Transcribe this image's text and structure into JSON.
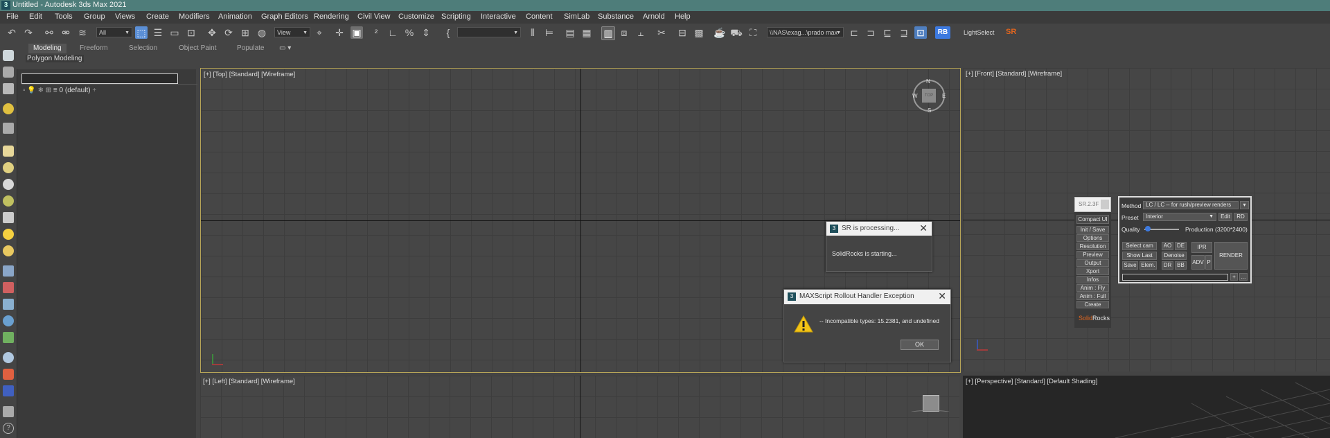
{
  "window": {
    "title": "Untitled - Autodesk 3ds Max 2021",
    "app_icon": "3"
  },
  "menu": [
    "File",
    "Edit",
    "Tools",
    "Group",
    "Views",
    "Create",
    "Modifiers",
    "Animation",
    "Graph Editors",
    "Rendering",
    "Civil View",
    "Customize",
    "Scripting",
    "Interactive",
    "Content",
    "SimLab",
    "Substance",
    "Arnold",
    "Help"
  ],
  "toolbar": {
    "selection_filter": "All",
    "ref_coord": "View",
    "named_sel": "",
    "path": "\\\\NAS\\exag...\\prado max",
    "rb_label": "RB",
    "lightselect_label": "LightSelect",
    "sr_label": "SR"
  },
  "ribbon": {
    "tabs": [
      "Modeling",
      "Freeform",
      "Selection",
      "Object Paint",
      "Populate"
    ],
    "active_tab": "Modeling",
    "sub_label": "Polygon Modeling"
  },
  "explorer": {
    "search_value": "",
    "layer_label": "0 (default)"
  },
  "viewports": {
    "top": "[+] [Top] [Standard] [Wireframe]",
    "front": "[+] [Front] [Standard] [Wireframe]",
    "left": "[+] [Left] [Standard] [Wireframe]",
    "persp": "[+] [Perspective] [Standard] [Default Shading]",
    "compass": {
      "n": "N",
      "s": "S",
      "e": "E",
      "w": "W",
      "cube": "TOP"
    }
  },
  "sr_processing": {
    "title": "SR is processing...",
    "message": "SolidRocks is starting..."
  },
  "maxscript_error": {
    "title": "MAXScript Rollout Handler Exception",
    "message": "-- Incompatible types: 15.2381, and undefined",
    "ok_label": "OK"
  },
  "solidrocks": {
    "version": "SR.2.3F",
    "buttons": [
      "Compact UI",
      "Init / Save",
      "Options",
      "Resolution",
      "Preview",
      "Output",
      "Xport",
      "Infos",
      "Anim : Fly",
      "Anim : Full",
      "Create"
    ],
    "logo_a": "Solid",
    "logo_b": "Rocks",
    "method_label": "Method",
    "method_value": "LC / LC -- for rush/preview renders",
    "preset_label": "Preset",
    "preset_value": "Interior",
    "edit_label": "Edit",
    "rd_label": "RD",
    "quality_label": "Quality",
    "quality_value": "Production  (3200*2400)",
    "quality_level": 0.05,
    "select_cam": "Select cam",
    "show_last": "Show Last",
    "save": "Save",
    "elem": "Elem.",
    "ao": "AO",
    "de": "DE",
    "denoise": "Denoise",
    "dr": "DR",
    "bb": "BB",
    "ipr": "IPR",
    "adv": "ADV",
    "p": "P",
    "render": "RENDER",
    "plus": "+",
    "dots": "..."
  },
  "colors": {
    "title_bar": "#4e7d7a",
    "accent_blue": "#5b8fd6",
    "sr_orange": "#e0651e",
    "warning_yellow": "#f2c316"
  }
}
